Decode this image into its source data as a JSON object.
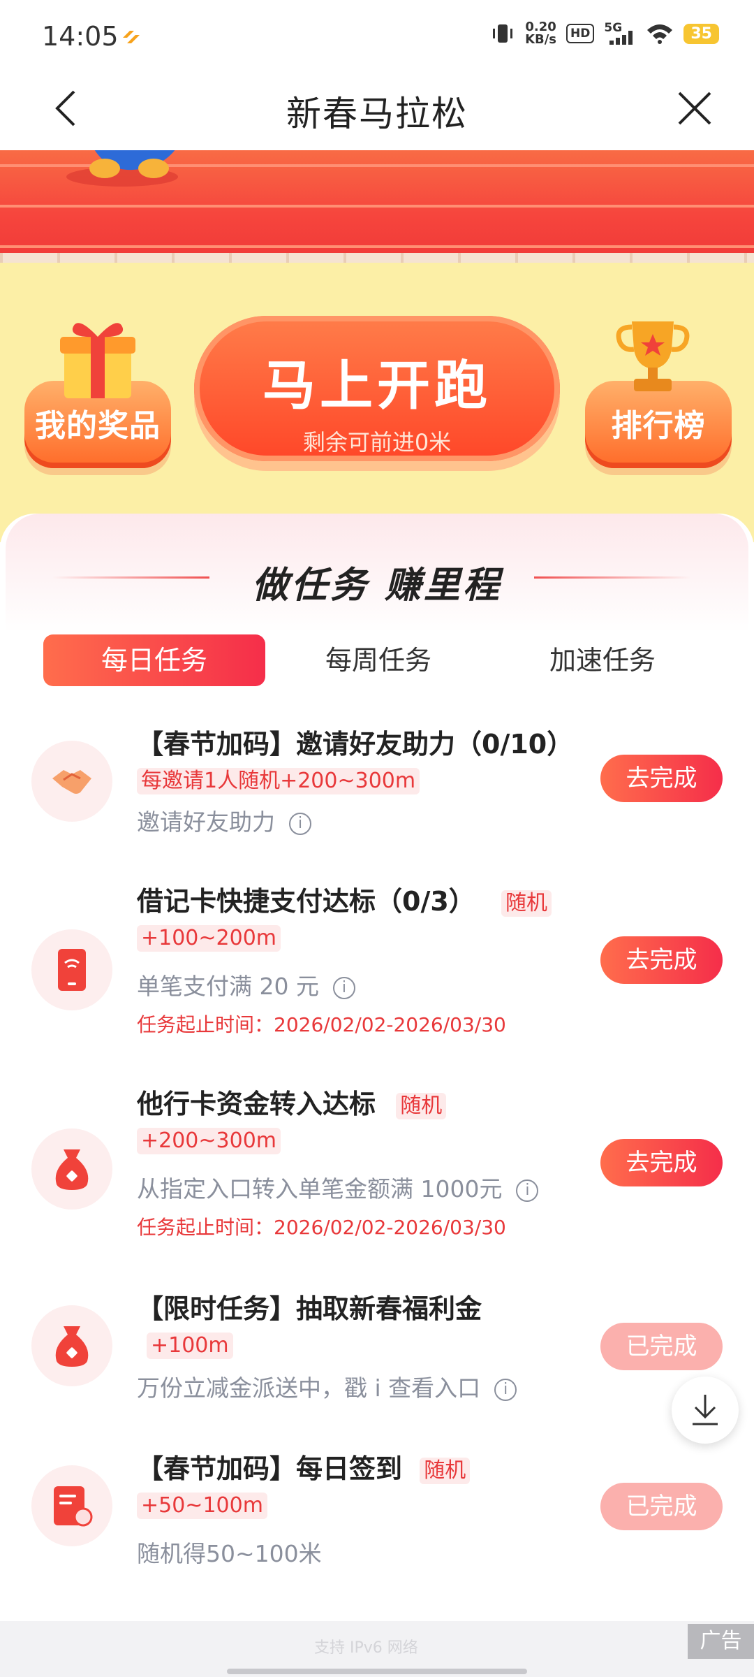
{
  "status_bar": {
    "time": "14:05",
    "net_speed_value": "0.20",
    "net_speed_unit": "KB/s",
    "hd": "HD",
    "signal": "5G",
    "battery": "35"
  },
  "header": {
    "title": "新春马拉松",
    "back_icon": "chevron-left-icon",
    "close_icon": "close-icon"
  },
  "hero": {
    "left_button": "我的奖品",
    "run_button": "马上开跑",
    "run_subtitle": "剩余可前进0米",
    "right_button": "排行榜"
  },
  "tasks_section": {
    "title": "做任务 赚里程",
    "tabs": [
      "每日任务",
      "每周任务",
      "加速任务"
    ],
    "active_tab": 0,
    "items": [
      {
        "icon": "handshake-icon",
        "name": "【春节加码】邀请好友助力（0/10）",
        "reward": "每邀请1人随机+200~300m",
        "desc": "邀请好友助力",
        "time": "",
        "button": "去完成",
        "done": false
      },
      {
        "icon": "card-icon",
        "name": "借记卡快捷支付达标（0/3）",
        "tag": "随机",
        "reward": "+100~200m",
        "desc": "单笔支付满 20 元",
        "time": "任务起止时间：2026/02/02-2026/03/30",
        "button": "去完成",
        "done": false
      },
      {
        "icon": "money-bag-icon",
        "name": "他行卡资金转入达标",
        "tag": "随机",
        "reward": "+200~300m",
        "desc": "从指定入口转入单笔金额满 1000元",
        "time": "任务起止时间：2026/02/02-2026/03/30",
        "button": "去完成",
        "done": false
      },
      {
        "icon": "money-bag-icon",
        "name": "【限时任务】抽取新春福利金",
        "reward": "+100m",
        "desc": "万份立减金派送中，戳 i 查看入口",
        "time": "",
        "button": "已完成",
        "done": true
      },
      {
        "icon": "checkin-icon",
        "name": "【春节加码】每日签到",
        "tag": "随机",
        "reward": "+50~100m",
        "desc": "随机得50~100米",
        "time": "",
        "button": "已完成",
        "done": true
      }
    ]
  },
  "info_icon": "i",
  "floating": {
    "icon": "download-icon"
  },
  "footer": {
    "ipv6_text": "支持 IPv6 网络",
    "ad_label": "广告"
  },
  "colors": {
    "accent": "#f52e4a",
    "track": "#f6453d",
    "panel": "#fcefa6",
    "done_button": "#fbb0ad"
  }
}
